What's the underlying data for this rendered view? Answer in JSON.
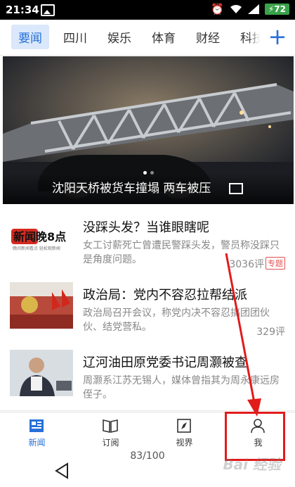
{
  "status_bar": {
    "time": "21:34",
    "battery": "72"
  },
  "tabs": [
    "要闻",
    "四川",
    "娱乐",
    "体育",
    "财经",
    "科技"
  ],
  "hero": {
    "caption": "沈阳天桥被货车撞塌 两车被压"
  },
  "news": [
    {
      "title": "没踩头发？当谁眼瞎呢",
      "summary": "女工讨薪死亡曾遭民警踩头发，警员称没踩只是角度问题。",
      "comments": "3036评",
      "tag": "专题",
      "thumb_text": "新闻晚8点",
      "thumb_subtext": "晚间新闻看点 轻松观新闻"
    },
    {
      "title": "政治局：党内不容忍拉帮结派",
      "summary": "政治局召开会议，称党内决不容忍搞团团伙伙、结党营私。",
      "comments": "329评"
    },
    {
      "title": "辽河油田原党委书记周灏被查",
      "summary": "周灏系江苏无锡人，媒体曾指其为周永康远房侄子。"
    }
  ],
  "nav": [
    {
      "label": "新闻",
      "icon": "newspaper-icon"
    },
    {
      "label": "订阅",
      "icon": "book-icon"
    },
    {
      "label": "视界",
      "icon": "compass-icon"
    },
    {
      "label": "我",
      "icon": "person-icon"
    }
  ],
  "page_indicator": "83/100",
  "watermark": "Bai 经验",
  "colors": {
    "accent": "#2670d8",
    "annotation": "#e21b1b",
    "tag": "#e45050"
  }
}
